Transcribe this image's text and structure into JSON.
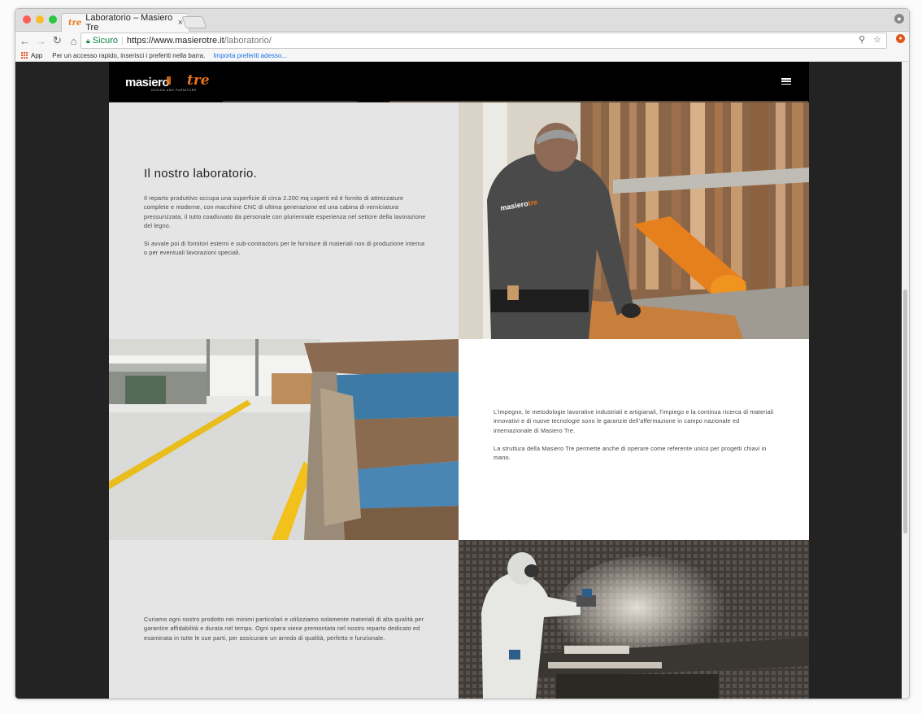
{
  "browser": {
    "tab_title": "Laboratorio – Masiero Tre",
    "tab_favicon": "tre",
    "tab_close": "×",
    "secure_label": "Sicuro",
    "url_main": "https://www.masierotre.it",
    "url_path": "/laboratorio/",
    "back_icon": "←",
    "forward_icon": "→",
    "reload_icon": "↻",
    "home_icon": "⌂",
    "zoom_icon": "⚲",
    "star_icon": "☆",
    "bookmarks": {
      "apps_label": "App",
      "hint": "Per un accesso rapido, inserisci i preferiti nella barra.",
      "import_link": "Importa preferiti adesso..."
    }
  },
  "site": {
    "logo": {
      "primary": "masiero",
      "accent": "tre",
      "tagline": "DESIGN AND FURNITURE"
    },
    "colors": {
      "brand_orange": "#e8731f",
      "header_bg": "#000000",
      "panel_grey": "#e5e5e5",
      "panel_white": "#ffffff"
    },
    "section1": {
      "heading": "Il nostro laboratorio.",
      "para1": "Il reparto produttivo occupa una superficie di circa 2.200 mq coperti ed è fornito di attrezzature complete e moderne, con macchine CNC di ultima generazione ed una cabina di verniciatura pressurizzata, il tutto coadiuvato da personale con pluriennale esperienza nel settore della lavorazione del legno.",
      "para2": "Si avvale poi di fornitori esterni e sub-contractors per le forniture di materiali non di produzione interna o per eventuali lavorazioni speciali."
    },
    "section2": {
      "para1": "L'impegno, le metodologie lavorative industriali e artigianali, l'impiego e la continua ricerca di materiali innovativi e di nuove tecnologie sono le garanzie dell'affermazione in campo nazionale ed internazionale di Masiero Tre.",
      "para2": "La struttura della Masiero Tre permette anche di operare come referente unico per progetti chiavi in mano."
    },
    "section3": {
      "para1": "Curiamo ogni nostro prodotto nei minimi particolari e utilizziamo solamente materiali di alta qualità per garantire affidabilità e durata nel tempo. Ogni opera viene premontata nel nostro reparto dedicato ed esaminata in tutte le sue parti, per assicurare un arredo di qualità, perfetto e funzionale."
    }
  }
}
